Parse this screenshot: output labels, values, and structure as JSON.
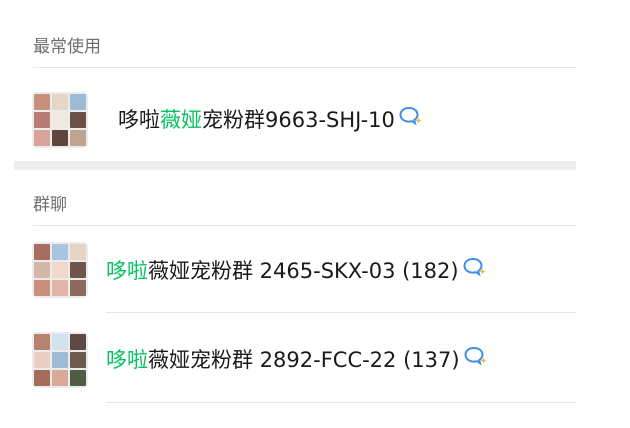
{
  "sections": {
    "frequent_label": "最常使用",
    "groups_label": "群聊"
  },
  "frequent": [
    {
      "name_pre": "哆啦",
      "name_hl": "薇娅",
      "name_post": "宠粉群9663-SHJ-10",
      "icon": "chat-bubble-icon",
      "avatar_tiles": [
        "#c98f7d",
        "#e7d6c8",
        "#9cbcd6",
        "#b97c72",
        "#f0e8e2",
        "#6b5046",
        "#d8a497",
        "#5f453b",
        "#bfa58f"
      ]
    }
  ],
  "groups": [
    {
      "name_pre": "",
      "name_hl": "哆啦",
      "name_post": "薇娅宠粉群 2465-SKX-03 (182)",
      "icon": "chat-bubble-icon",
      "avatar_tiles": [
        "#a86d5e",
        "#a7c4e0",
        "#e5d3c6",
        "#d4b7a8",
        "#f2d7cc",
        "#70554a",
        "#c98f7d",
        "#e0b5a8",
        "#8a6a5c"
      ]
    },
    {
      "name_pre": "",
      "name_hl": "哆啦",
      "name_post": "薇娅宠粉群 2892-FCC-22 (137)",
      "icon": "chat-bubble-icon",
      "avatar_tiles": [
        "#b7826f",
        "#d3e2ef",
        "#5d4a42",
        "#e8cfc2",
        "#9bbad4",
        "#6e5a4f",
        "#a56b5a",
        "#d9a898",
        "#4f5d44"
      ]
    }
  ],
  "colors": {
    "highlight": "#07c160",
    "text": "#1a1a1a",
    "section_label": "#6f6f6f",
    "icon_blue": "#3f8fe8",
    "icon_yellow": "#f3b53a"
  }
}
